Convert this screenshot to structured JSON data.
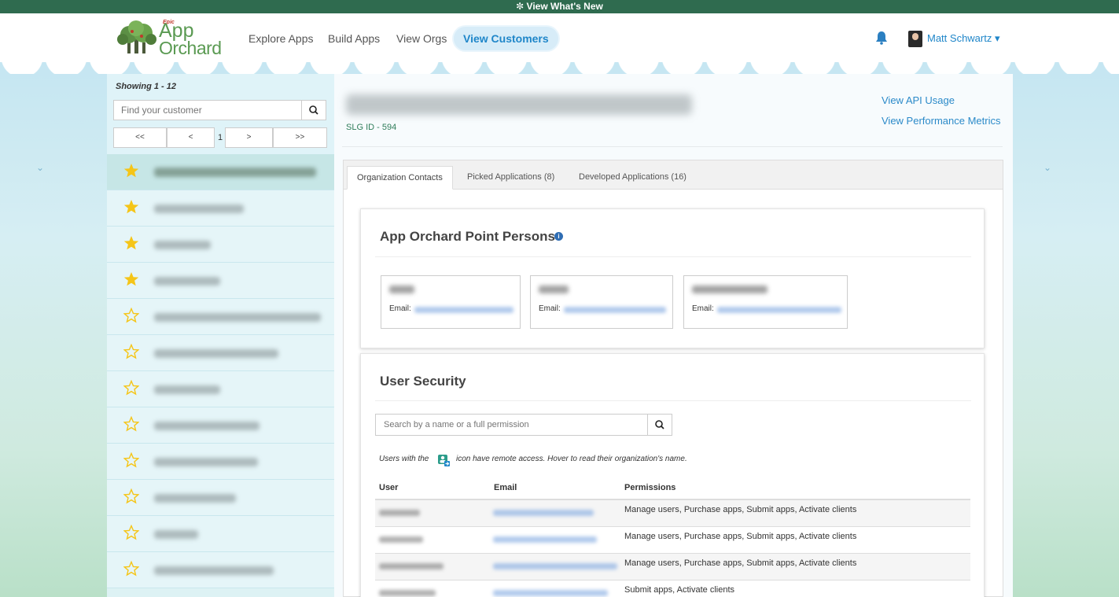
{
  "banner": {
    "text": "✼ View What's New"
  },
  "header": {
    "logo": {
      "epic": "Epic",
      "app": "App",
      "orchard": "Orchard"
    },
    "nav": [
      {
        "label": "Explore Apps"
      },
      {
        "label": "Build Apps"
      },
      {
        "label": "View Orgs"
      },
      {
        "label": "View Customers",
        "active": true
      }
    ],
    "user": {
      "name": "Matt Schwartz ▾"
    }
  },
  "sidebar": {
    "showing": "Showing 1 - 12",
    "search_placeholder": "Find your customer",
    "pager": {
      "first": "<<",
      "prev": "<",
      "page": "1",
      "next": ">",
      "last": ">>"
    },
    "customers": [
      {
        "starred": true,
        "selected": true
      },
      {
        "starred": true
      },
      {
        "starred": true
      },
      {
        "starred": true
      },
      {
        "starred": false
      },
      {
        "starred": false
      },
      {
        "starred": false
      },
      {
        "starred": false
      },
      {
        "starred": false
      },
      {
        "starred": false
      },
      {
        "starred": false
      },
      {
        "starred": false
      }
    ]
  },
  "main": {
    "slg": "SLG ID - 594",
    "links": {
      "api_usage": "View API Usage",
      "performance": "View Performance Metrics"
    },
    "tabs": [
      {
        "label": "Organization Contacts",
        "active": true
      },
      {
        "label": "Picked Applications (8)"
      },
      {
        "label": "Developed Applications (16)"
      }
    ],
    "point_persons": {
      "title": "App Orchard Point Persons",
      "info": "i",
      "email_label": "Email:"
    },
    "user_security": {
      "title": "User Security",
      "search_placeholder": "Search by a name or a full permission",
      "note_a": "Users with the",
      "note_b": "icon have remote access. Hover to read their organization's name.",
      "columns": {
        "user": "User",
        "email": "Email",
        "permissions": "Permissions"
      },
      "rows": [
        {
          "permissions": "Manage users, Purchase apps, Submit apps, Activate clients"
        },
        {
          "permissions": "Manage users, Purchase apps, Submit apps, Activate clients"
        },
        {
          "permissions": "Manage users, Purchase apps, Submit apps, Activate clients"
        },
        {
          "permissions": "Submit apps, Activate clients"
        }
      ]
    }
  },
  "colors": {
    "banner": "#2f6b4f",
    "accent": "#1f86c9",
    "star": "#f5c518"
  }
}
